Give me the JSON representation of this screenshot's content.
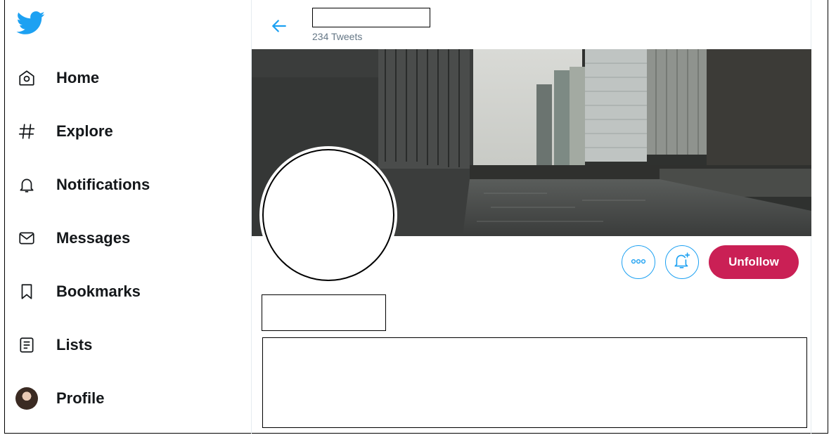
{
  "sidebar": {
    "logo": "twitter-bird-icon",
    "items": [
      {
        "label": "Home",
        "icon": "home-icon"
      },
      {
        "label": "Explore",
        "icon": "hashtag-icon"
      },
      {
        "label": "Notifications",
        "icon": "bell-icon"
      },
      {
        "label": "Messages",
        "icon": "envelope-icon"
      },
      {
        "label": "Bookmarks",
        "icon": "bookmark-icon"
      },
      {
        "label": "Lists",
        "icon": "list-icon"
      },
      {
        "label": "Profile",
        "icon": "avatar"
      }
    ]
  },
  "header": {
    "back_icon": "back-arrow-icon",
    "tweet_count": "234 Tweets"
  },
  "profile": {
    "more_icon": "more-dots-icon",
    "notify_icon": "bell-plus-icon",
    "unfollow_label": "Unfollow"
  },
  "colors": {
    "accent": "#1da1f2",
    "unfollow": "#ca2055",
    "text": "#14171a",
    "muted": "#657786"
  }
}
